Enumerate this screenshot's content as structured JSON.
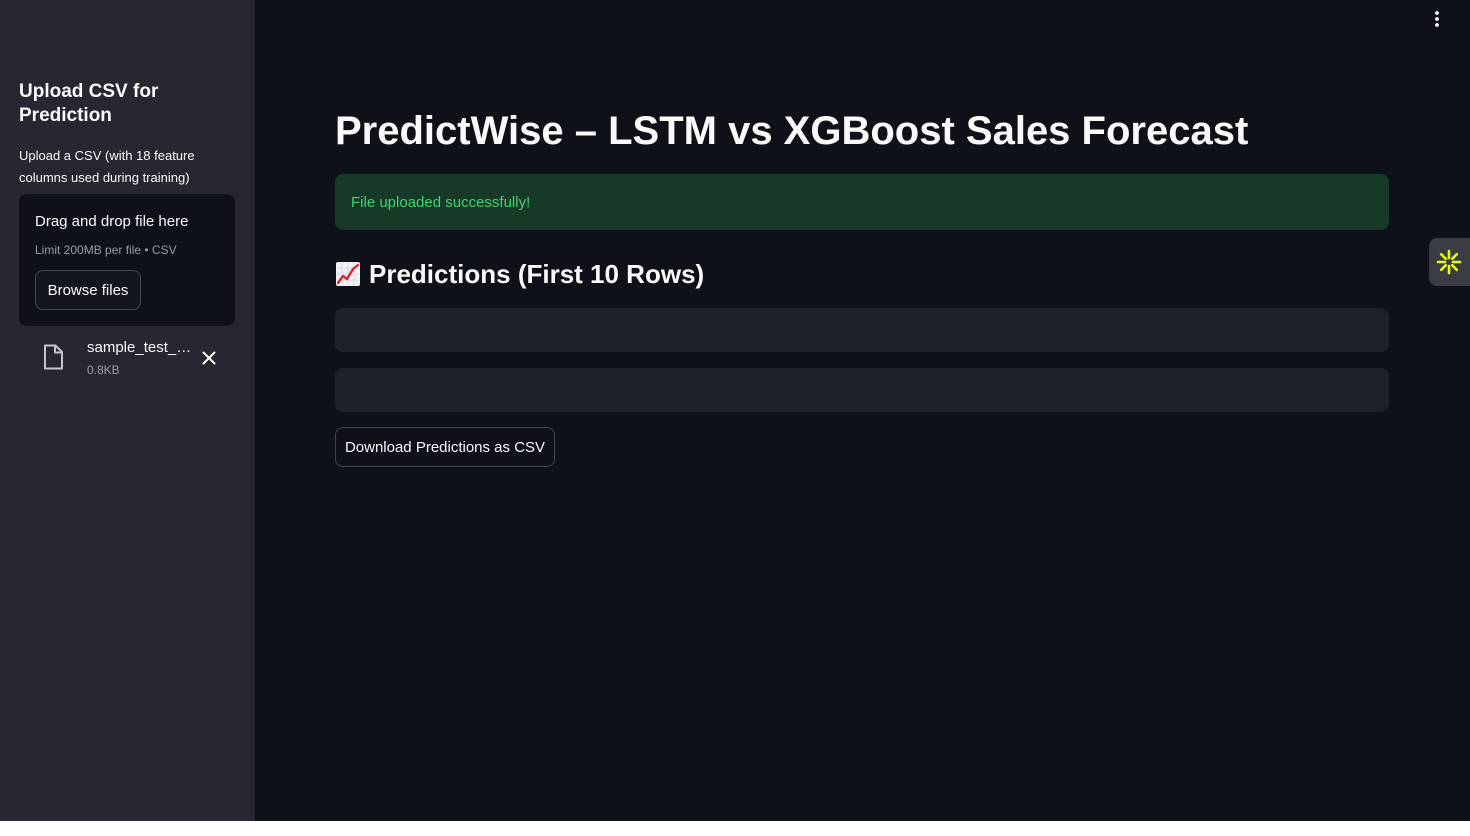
{
  "sidebar": {
    "title": "Upload CSV for Prediction",
    "description": "Upload a CSV (with 18 feature columns used during training)",
    "uploader": {
      "drag_text": "Drag and drop file here",
      "limit_text": "Limit 200MB per file • CSV",
      "browse_label": "Browse files"
    },
    "file": {
      "name": "sample_test_…",
      "size": "0.8KB"
    }
  },
  "main": {
    "title": "PredictWise – LSTM vs XGBoost Sales Forecast",
    "success_message": "File uploaded successfully!",
    "section_header": "Predictions (First 10 Rows)",
    "download_label": "Download Predictions as CSV"
  },
  "icons": {
    "menu": "vertical-dots-icon",
    "file": "file-icon",
    "remove": "close-icon",
    "section": "chart-increasing-icon",
    "side_tab": "sparkle-icon"
  },
  "colors": {
    "app_background": "#0e1117",
    "sidebar_background": "#262730",
    "success_background": "#173928",
    "success_text": "#3dd56d",
    "side_tab_icon": "#e6ff00"
  }
}
